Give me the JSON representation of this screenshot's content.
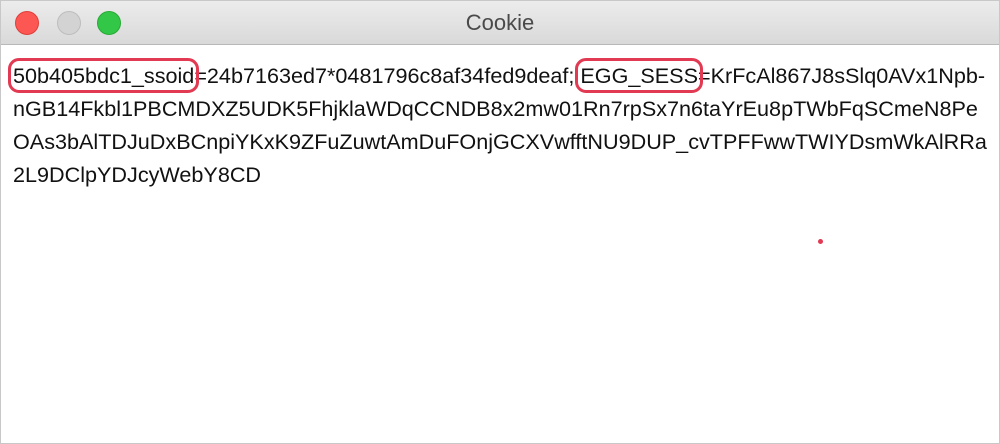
{
  "window": {
    "title": "Cookie"
  },
  "cookie": {
    "key1": "50b405bdc1_ssoid",
    "value1_prefix": "=24b7163ed7*0481796c8af34fed9deaf; ",
    "key2": "EGG_SESS",
    "value2": "=KrFcAl867J8sSlq0AVx1Npb-nGB14Fkbl1PBCMDXZ5UDK5FhjklaWDqCCNDB8x2mw01Rn7rpSx7n6taYrEu8pTWbFqSCmeN8PeOAs3bAlTDJuDxBCnpiYKxK9ZFuZuwtAmDuFOnjGCXVwfftNU9DUP_cvTPFFwwTWIYDsmWkAlRRa2L9DClpYDJcyWebY8CD"
  },
  "colors": {
    "highlight": "#e23a52",
    "close": "#fc5753",
    "minimize": "#d3d3d3",
    "zoom": "#33c748"
  }
}
